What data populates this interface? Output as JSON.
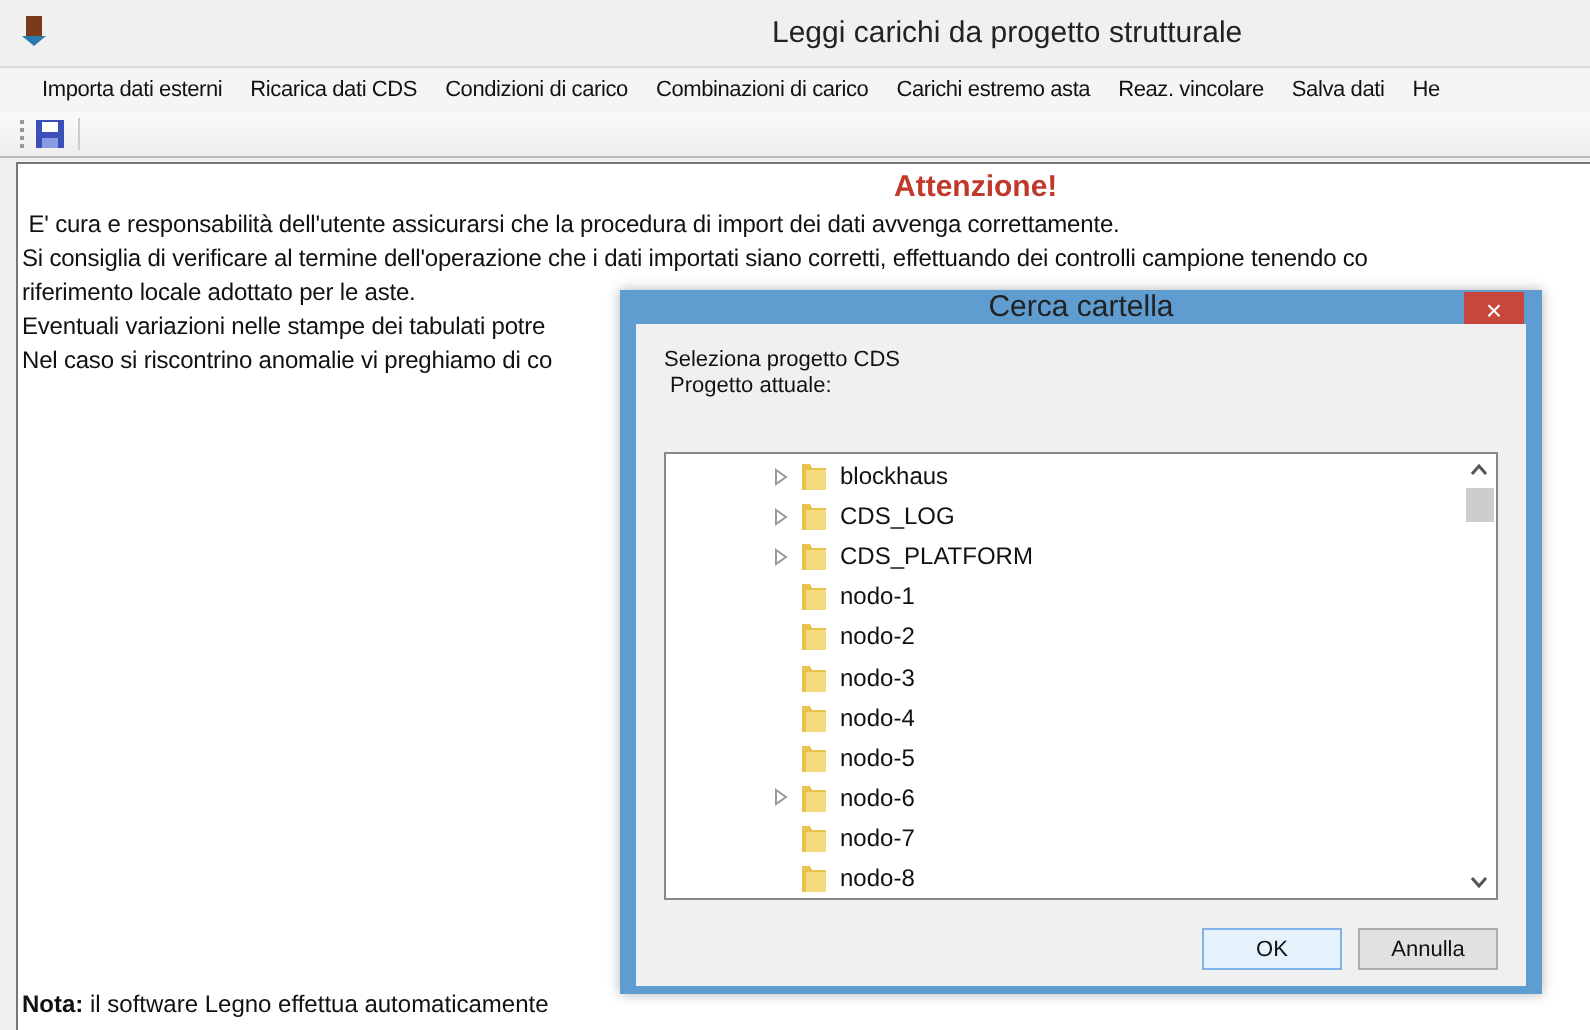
{
  "window": {
    "title": "Leggi carichi da progetto strutturale"
  },
  "menu": [
    "Importa dati esterni",
    "Ricarica dati CDS",
    "Condizioni di carico",
    "Combinazioni di carico",
    "Carichi estremo asta",
    "Reaz. vincolare",
    "Salva dati",
    "He"
  ],
  "content": {
    "heading": "Attenzione!",
    "lines": [
      " E' cura e responsabilità dell'utente assicurarsi che la procedura di import dei dati avvenga correttamente.",
      "Si consiglia di verificare al termine dell'operazione che i dati importati siano corretti, effettuando dei controlli campione tenendo co",
      "riferimento locale adottato per le aste.",
      "Eventuali variazioni nelle stampe dei tabulati potre",
      "Nel caso si riscontrino anomalie vi preghiamo di co"
    ],
    "note": "**Nota:** il software Legno effettua automaticamente"
  },
  "dialog": {
    "title": "Cerca cartella",
    "close": "×",
    "prompt": "Seleziona progetto CDS",
    "current": " Progetto attuale:",
    "folders": [
      {
        "name": "blockhaus",
        "expandable": true
      },
      {
        "name": "CDS_LOG",
        "expandable": true
      },
      {
        "name": "CDS_PLATFORM",
        "expandable": true
      },
      {
        "name": "nodo-1",
        "expandable": false
      },
      {
        "name": "nodo-2",
        "expandable": false
      },
      {
        "name": "nodo-3",
        "expandable": false
      },
      {
        "name": "nodo-4",
        "expandable": false
      },
      {
        "name": "nodo-5",
        "expandable": false
      },
      {
        "name": "nodo-6",
        "expandable": true
      },
      {
        "name": "nodo-7",
        "expandable": false
      },
      {
        "name": "nodo-8",
        "expandable": false
      }
    ],
    "buttons": [
      {
        "label": "OK",
        "kind": "default"
      },
      {
        "label": "Annulla",
        "kind": "normal"
      }
    ]
  }
}
